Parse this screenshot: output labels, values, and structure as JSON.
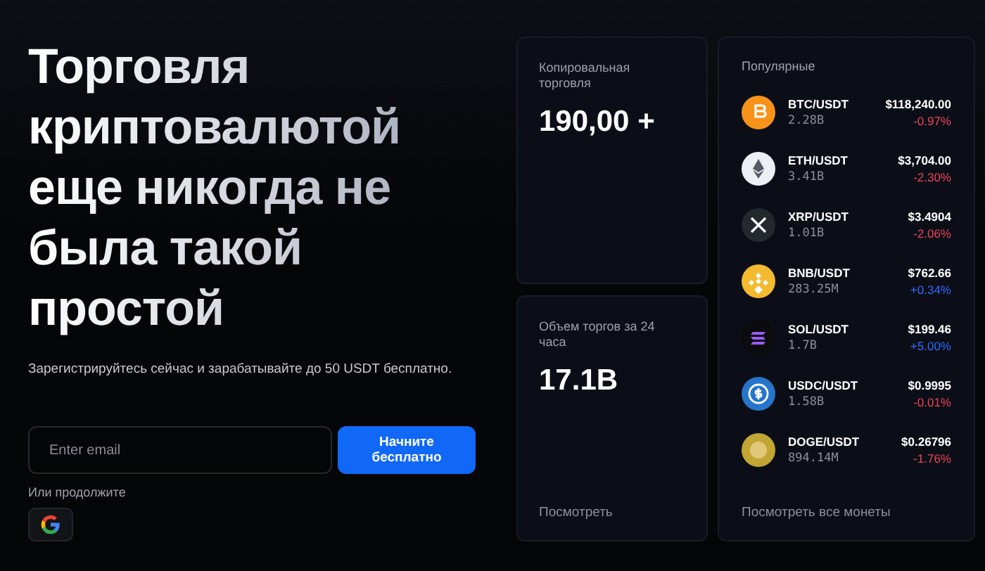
{
  "hero": {
    "title": "Торговля криптовалютой еще никогда не была такой простой",
    "subtitle": "Зарегистрируйтесь сейчас и зарабатывайте до 50 USDT бесплатно.",
    "email": {
      "placeholder": "Enter email"
    },
    "cta": "Начните бесплатно",
    "alt_label": "Или продолжите"
  },
  "stats": [
    {
      "label": "Копировальная торговля",
      "value": "190,00 +"
    },
    {
      "label": "Объем торгов за 24 часа",
      "value": "17.1B",
      "link": "Посмотреть"
    }
  ],
  "popular": {
    "title": "Популярные",
    "link": "Посмотреть все монеты",
    "coins": [
      {
        "pair": "BTC/USDT",
        "volume": "2.28B",
        "price": "$118,240.00",
        "change": "-0.97%",
        "positive": false,
        "color": "#f7931a"
      },
      {
        "pair": "ETH/USDT",
        "volume": "3.41B",
        "price": "$3,704.00",
        "change": "-2.30%",
        "positive": false,
        "color": "#eceff4"
      },
      {
        "pair": "XRP/USDT",
        "volume": "1.01B",
        "price": "$3.4904",
        "change": "-2.06%",
        "positive": false,
        "color": "#23292f"
      },
      {
        "pair": "BNB/USDT",
        "volume": "283.25M",
        "price": "$762.66",
        "change": "+0.34%",
        "positive": true,
        "color": "#f3ba2f"
      },
      {
        "pair": "SOL/USDT",
        "volume": "1.7B",
        "price": "$199.46",
        "change": "+5.00%",
        "positive": true,
        "color": "#0b0b10"
      },
      {
        "pair": "USDC/USDT",
        "volume": "1.58B",
        "price": "$0.9995",
        "change": "-0.01%",
        "positive": false,
        "color": "#2775ca"
      },
      {
        "pair": "DOGE/USDT",
        "volume": "894.14M",
        "price": "$0.26796",
        "change": "-1.76%",
        "positive": false,
        "color": "#c2a633"
      }
    ]
  }
}
